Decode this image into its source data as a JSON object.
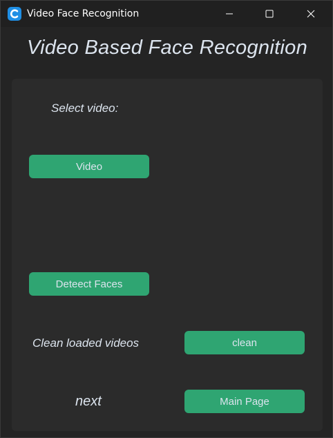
{
  "window": {
    "title": "Video Face Recognition",
    "controls": {
      "minimize": "minimize-icon",
      "maximize": "maximize-icon",
      "close": "close-icon"
    },
    "app_icon": "customtkinter-app-icon"
  },
  "main": {
    "heading": "Video Based Face Recognition",
    "select_label": "Select video:",
    "video_button": "Video",
    "detect_button": "Deteect Faces",
    "clean_label": "Clean loaded videos",
    "clean_button": "clean",
    "next_label": "next",
    "main_page_button": "Main Page"
  },
  "colors": {
    "accent": "#2fa572",
    "background": "#242424",
    "frame": "#2b2b2b",
    "text": "#dce4ee",
    "app_icon": "#1f8fe5"
  }
}
